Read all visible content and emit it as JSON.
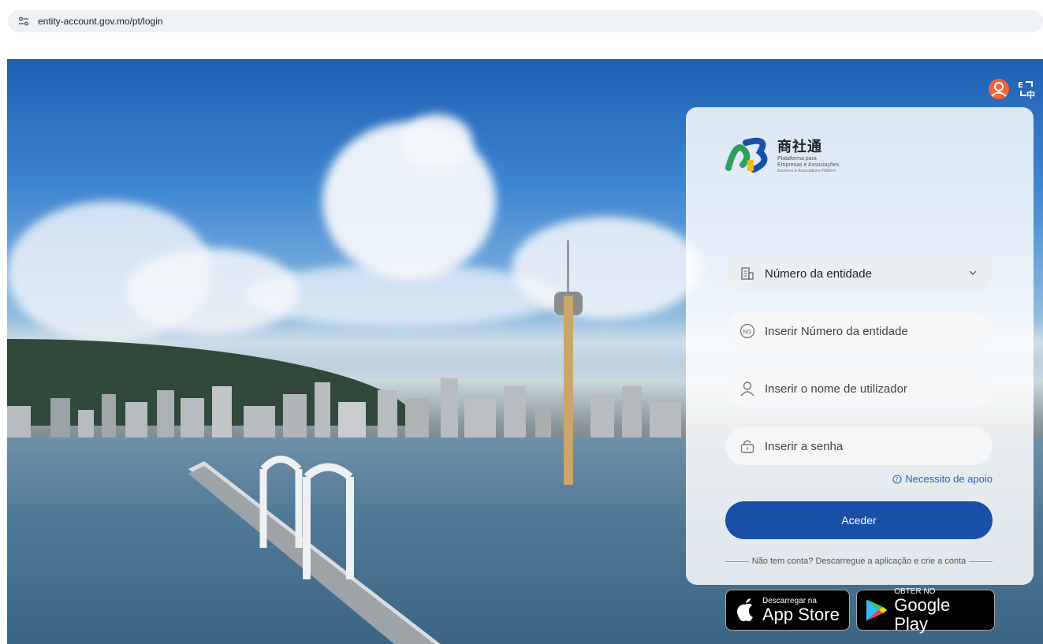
{
  "browser": {
    "url": "entity-account.gov.mo/pt/login"
  },
  "header_icons": {
    "user": "user-circle-icon",
    "language": "language-switch-icon"
  },
  "brand": {
    "name_cn": "商社通",
    "subtitle_pt": "Plataforma para Empresas e Associações",
    "subtitle_en": "Business & Associations Platform"
  },
  "form": {
    "login_type_value": "Número da entidade",
    "entity_number_placeholder": "Inserir Número da entidade",
    "username_placeholder": "Inserir o nome de utilizador",
    "password_placeholder": "Inserir a senha",
    "help_link": "Necessito de apoio",
    "submit_label": "Aceder",
    "signup_note": "Não tem conta? Descarregue a aplicação e crie a conta"
  },
  "stores": {
    "apple_small": "Descarregar na",
    "apple_big": "App Store",
    "google_small": "OBTER NO",
    "google_big": "Google Play"
  },
  "colors": {
    "primary": "#1a4fa8",
    "accent_user_icon": "#f2643a",
    "link": "#2a63b8"
  }
}
